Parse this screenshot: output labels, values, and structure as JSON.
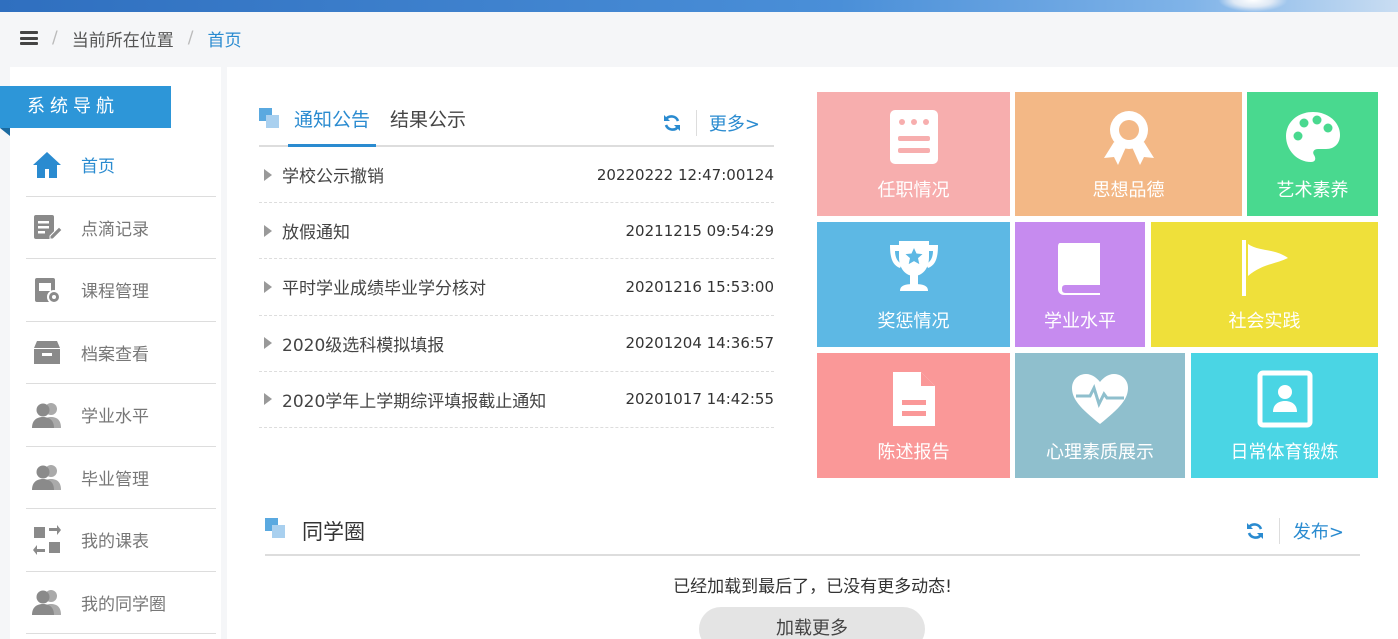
{
  "breadcrumb": {
    "label": "当前所在位置",
    "current": "首页"
  },
  "sidebar": {
    "title": "系统导航",
    "items": [
      {
        "label": "首页",
        "icon": "home-icon"
      },
      {
        "label": "点滴记录",
        "icon": "edit-record-icon"
      },
      {
        "label": "课程管理",
        "icon": "course-settings-icon"
      },
      {
        "label": "档案查看",
        "icon": "archive-box-icon"
      },
      {
        "label": "学业水平",
        "icon": "users-icon"
      },
      {
        "label": "毕业管理",
        "icon": "users-icon"
      },
      {
        "label": "我的课表",
        "icon": "swap-schedule-icon"
      },
      {
        "label": "我的同学圈",
        "icon": "users-icon"
      }
    ]
  },
  "notice": {
    "tabs": [
      "通知公告",
      "结果公示"
    ],
    "more": "更多>",
    "items": [
      {
        "title": "学校公示撤销",
        "date": "20220222 12:47:00124"
      },
      {
        "title": "放假通知",
        "date": "20211215 09:54:29"
      },
      {
        "title": "平时学业成绩毕业学分核对",
        "date": "20201216 15:53:00"
      },
      {
        "title": "2020级选科模拟填报",
        "date": "20201204 14:36:57"
      },
      {
        "title": "2020学年上学期综评填报截止通知",
        "date": "20201017 14:42:55"
      }
    ]
  },
  "tiles": [
    {
      "label": "任职情况",
      "color": "#f7aeae",
      "icon": "document-list-icon"
    },
    {
      "label": "思想品德",
      "color": "#f3b886",
      "icon": "award-ribbon-icon"
    },
    {
      "label": "艺术素养",
      "color": "#49d98f",
      "icon": "palette-icon"
    },
    {
      "label": "奖惩情况",
      "color": "#5db8e4",
      "icon": "trophy-icon"
    },
    {
      "label": "学业水平",
      "color": "#c68bef",
      "icon": "book-icon"
    },
    {
      "label": "社会实践",
      "color": "#efe03a",
      "icon": "flag-icon"
    },
    {
      "label": "陈述报告",
      "color": "#fa9898",
      "icon": "report-file-icon"
    },
    {
      "label": "心理素质展示",
      "color": "#8fbfcd",
      "icon": "heart-pulse-icon"
    },
    {
      "label": "日常体育锻炼",
      "color": "#4ad5e4",
      "icon": "profile-card-icon"
    }
  ],
  "circle": {
    "title": "同学圈",
    "publish": "发布>",
    "message": "已经加载到最后了，已没有更多动态!",
    "load_more": "加载更多"
  },
  "colors": {
    "accent": "#2a8bd0",
    "nav_title_bg": "#2d96d8"
  }
}
